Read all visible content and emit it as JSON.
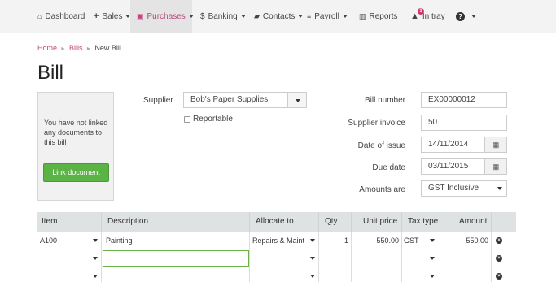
{
  "nav": {
    "items": [
      {
        "icon": "home-icon",
        "glyph": "⌂",
        "label": "Dashboard",
        "dropdown": false
      },
      {
        "icon": "plus-icon",
        "glyph": "+",
        "label": "Sales",
        "dropdown": true
      },
      {
        "icon": "money-icon",
        "glyph": "▣",
        "label": "Purchases",
        "dropdown": true
      },
      {
        "icon": "dollar-icon",
        "glyph": "$",
        "label": "Banking",
        "dropdown": true
      },
      {
        "icon": "contacts-icon",
        "glyph": "▰",
        "label": "Contacts",
        "dropdown": true
      },
      {
        "icon": "list-icon",
        "glyph": "≡",
        "label": "Payroll",
        "dropdown": true
      },
      {
        "icon": "chart-icon",
        "glyph": "▥",
        "label": "Reports",
        "dropdown": false
      },
      {
        "icon": "tray-icon",
        "glyph": "▲",
        "label": "In tray",
        "badge": "1",
        "dropdown": false
      },
      {
        "icon": "help-icon",
        "glyph": "?",
        "label": "",
        "dropdown": true
      }
    ],
    "active": "Purchases",
    "accent": "#c7447e"
  },
  "breadcrumb": [
    "Home",
    "Bills",
    "New Bill"
  ],
  "page_title": "Bill",
  "documents": {
    "message": "You have not linked any documents to this bill",
    "link_button": "Link document"
  },
  "form": {
    "supplier_label": "Supplier",
    "supplier_value": "Bob's Paper Supplies",
    "reportable_label": "Reportable",
    "bill_number_label": "Bill number",
    "bill_number_value": "EX00000012",
    "supplier_invoice_label": "Supplier invoice",
    "supplier_invoice_value": "50",
    "date_of_issue_label": "Date of issue",
    "date_of_issue_value": "14/11/2014",
    "due_date_label": "Due date",
    "due_date_value": "03/11/2015",
    "amounts_are_label": "Amounts are",
    "amounts_are_value": "GST Inclusive"
  },
  "table": {
    "headers": [
      "Item",
      "Description",
      "Allocate to",
      "Qty",
      "Unit price",
      "Tax type",
      "Amount"
    ],
    "rows": [
      {
        "item": "A100",
        "description": "Painting",
        "allocate_to": "Repairs & Maint",
        "qty": "1",
        "unit_price": "550.00",
        "tax_type": "GST",
        "amount": "550.00"
      },
      {
        "item": "",
        "description": "",
        "allocate_to": "",
        "qty": "",
        "unit_price": "",
        "tax_type": "",
        "amount": ""
      },
      {
        "item": "",
        "description": "",
        "allocate_to": "",
        "qty": "",
        "unit_price": "",
        "tax_type": "",
        "amount": ""
      }
    ]
  },
  "colors": {
    "accent_pink": "#c7447e",
    "button_green": "#5bb346",
    "header_gray": "#dfe2e2"
  }
}
